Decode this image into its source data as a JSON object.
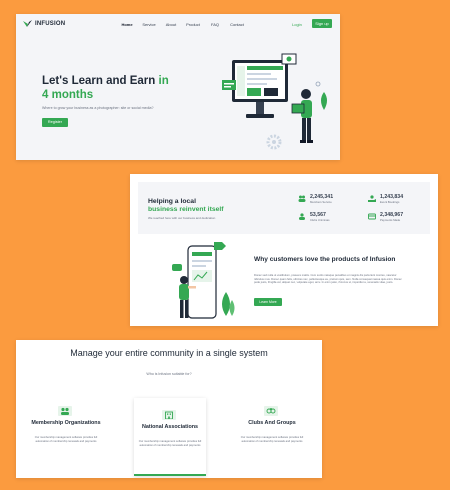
{
  "colors": {
    "background": "#fb9b3f",
    "accent": "#34a853",
    "text": "#1f2937",
    "muted": "#6b7280"
  },
  "hero": {
    "brand": "INFUSION",
    "nav": [
      "Home",
      "Service",
      "About",
      "Product",
      "FAQ",
      "Contact"
    ],
    "login": "Login",
    "signup": "Sign up",
    "title_line1": "Let's Learn and Earn",
    "title_in": "in",
    "title_line2": "4 months",
    "subtitle": "Where to grow your business as a photographer: site or social media?",
    "register": "Register"
  },
  "stats_section": {
    "title_line1": "Helping a local",
    "title_line2": "business reinvent itself",
    "subtitle": "We reached here with our business and dedication",
    "stats": [
      {
        "value": "2,245,341",
        "label": "Members Service",
        "icon": "users-icon"
      },
      {
        "value": "1,243,834",
        "label": "Event Bookings",
        "icon": "hand-coin-icon"
      },
      {
        "value": "53,567",
        "label": "Clubs Uniminas",
        "icon": "people-icon"
      },
      {
        "value": "2,348,967",
        "label": "Payments Made",
        "icon": "card-icon"
      }
    ]
  },
  "why": {
    "title": "Why customers love the products of Infusion",
    "body": "Donec sed nulla ut vestibulum, posuere mattis. Cum sociis natoque penatibus et magnis dis parturient montes, nascetur ridiculus mus. Donec quam felis, ultricies nec, pellentesque eu, pretium quis, sem. Nulla consequat massa quis enim. Donec pede justo, fringilla vel, aliquet nec, vulputate eget, arcu. In enim justo, rhoncus ut, imperdiet a, venenatis vitae, justo.",
    "button": "Learn More"
  },
  "manage": {
    "title": "Manage your entire community in a single system",
    "subtitle": "Who is Infusion suitable for?",
    "cards": [
      {
        "title": "Membership Organizations",
        "body": "Our membership management software provides full automation of membership renewals and payments",
        "icon": "members-icon"
      },
      {
        "title": "National Associations",
        "body": "Our membership management software provides full automation of membership renewals and payments",
        "icon": "building-icon"
      },
      {
        "title": "Clubs And Groups",
        "body": "Our membership management software provides full automation of membership renewals and payments",
        "icon": "clubs-icon"
      }
    ]
  }
}
